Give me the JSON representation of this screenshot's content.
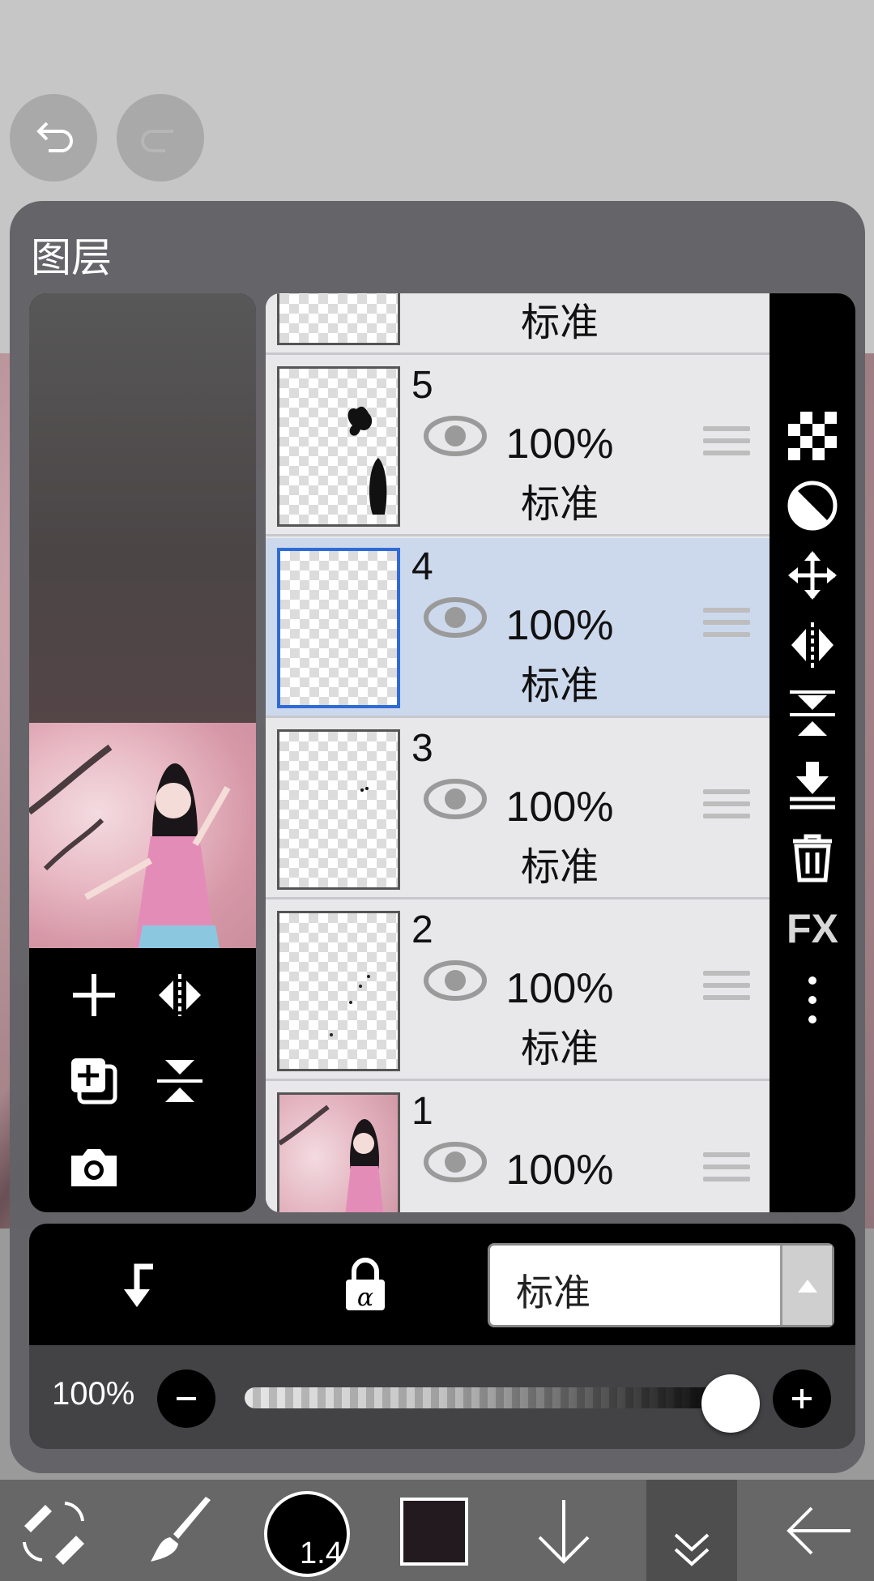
{
  "panel": {
    "title": "图层"
  },
  "layers": [
    {
      "number": "",
      "opacity": "",
      "blend": "标准",
      "visible": true,
      "selected": false
    },
    {
      "number": "5",
      "opacity": "100%",
      "blend": "标准",
      "visible": true,
      "selected": false
    },
    {
      "number": "4",
      "opacity": "100%",
      "blend": "标准",
      "visible": true,
      "selected": true
    },
    {
      "number": "3",
      "opacity": "100%",
      "blend": "标准",
      "visible": true,
      "selected": false
    },
    {
      "number": "2",
      "opacity": "100%",
      "blend": "标准",
      "visible": true,
      "selected": false
    },
    {
      "number": "1",
      "opacity": "100%",
      "blend": "",
      "visible": true,
      "selected": false
    }
  ],
  "side_tools": [
    "checkerboard-icon",
    "half-circle-icon",
    "move-arrows-icon",
    "flip-horizontal-icon",
    "flip-vertical-icon",
    "merge-down-icon",
    "trash-icon",
    "fx-icon",
    "more-vertical-icon"
  ],
  "side_fx_label": "FX",
  "left_tools": [
    "add-layer-icon",
    "flip-horizontal-icon",
    "duplicate-layer-icon",
    "flip-vertical-icon",
    "camera-icon"
  ],
  "action_bar": {
    "blend_mode": "标准"
  },
  "opacity_bar": {
    "label": "100%",
    "value": 1.0
  },
  "toolbar": {
    "brush_size": "1.4",
    "color": "#221a1e"
  },
  "colors": {
    "selected_row": "#ccd8ec",
    "selected_border": "#2f6bd6",
    "panel_bg": "#626266"
  }
}
